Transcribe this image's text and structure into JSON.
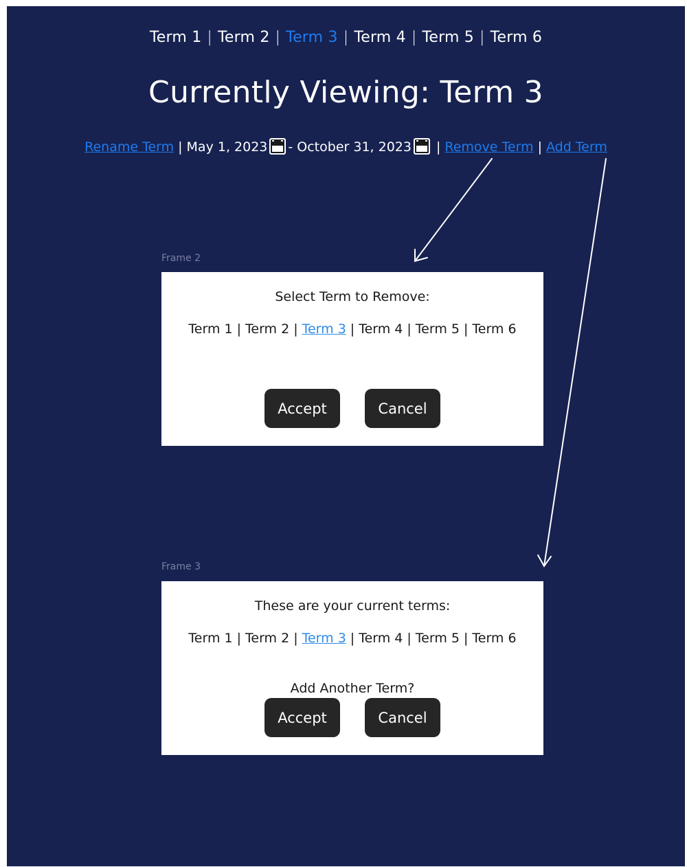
{
  "colors": {
    "background": "#172250",
    "accent": "#1f7bef",
    "dialog_bg": "#ffffff",
    "button_bg": "#262626"
  },
  "terms": [
    "Term 1",
    "Term 2",
    "Term 3",
    "Term 4",
    "Term 5",
    "Term 6"
  ],
  "active_term_index": 2,
  "page_title": "Currently Viewing: Term 3",
  "actions": {
    "rename": "Rename Term",
    "start_date": "May 1, 2023",
    "date_separator": "-",
    "end_date": "October 31, 2023",
    "remove": "Remove Term",
    "add": "Add Term"
  },
  "frame2": {
    "label": "Frame 2",
    "prompt": "Select Term to Remove:",
    "accept": "Accept",
    "cancel": "Cancel"
  },
  "frame3": {
    "label": "Frame 3",
    "prompt": "These are your current terms:",
    "question": "Add Another Term?",
    "accept": "Accept",
    "cancel": "Cancel"
  }
}
